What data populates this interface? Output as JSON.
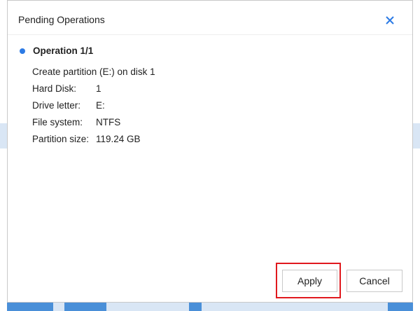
{
  "dialog": {
    "title": "Pending Operations",
    "close_icon": "close-icon",
    "accent_color": "#2d7be5"
  },
  "operation": {
    "header": "Operation 1/1",
    "description": "Create partition (E:) on disk 1",
    "details": [
      {
        "label": "Hard Disk:",
        "value": "1"
      },
      {
        "label": "Drive letter:",
        "value": "E:"
      },
      {
        "label": "File system:",
        "value": "NTFS"
      },
      {
        "label": "Partition size:",
        "value": "119.24 GB"
      }
    ]
  },
  "buttons": {
    "apply_label": "Apply",
    "cancel_label": "Cancel"
  },
  "highlight_color": "#e0191e"
}
